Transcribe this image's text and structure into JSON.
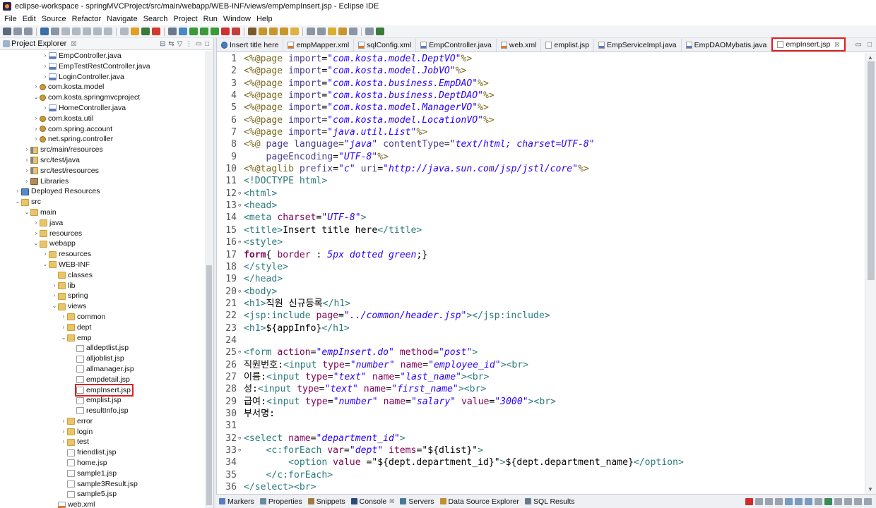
{
  "window": {
    "title": "eclipse-workspace - springMVCProject/src/main/webapp/WEB-INF/views/emp/empInsert.jsp - Eclipse IDE"
  },
  "menu": [
    "File",
    "Edit",
    "Source",
    "Refactor",
    "Navigate",
    "Search",
    "Project",
    "Run",
    "Window",
    "Help"
  ],
  "explorer": {
    "title": "Project Explorer",
    "close": "☒",
    "items": [
      {
        "depth": 5,
        "tw": "›",
        "icon": "java",
        "label": "EmpController.java"
      },
      {
        "depth": 5,
        "tw": "›",
        "icon": "java",
        "label": "EmpTestRestController.java"
      },
      {
        "depth": 5,
        "tw": "›",
        "icon": "java",
        "label": "LoginController.java"
      },
      {
        "depth": 4,
        "tw": "›",
        "icon": "pkg",
        "label": "com.kosta.model"
      },
      {
        "depth": 4,
        "tw": "⌄",
        "icon": "pkg",
        "label": "com.kosta.springmvcproject"
      },
      {
        "depth": 5,
        "tw": "›",
        "icon": "java",
        "label": "HomeController.java"
      },
      {
        "depth": 4,
        "tw": "›",
        "icon": "pkg",
        "label": "com.kosta.util"
      },
      {
        "depth": 4,
        "tw": "›",
        "icon": "pkg",
        "label": "com.spring.account"
      },
      {
        "depth": 4,
        "tw": "›",
        "icon": "pkg",
        "label": "net.spring.controller"
      },
      {
        "depth": 3,
        "tw": "›",
        "icon": "src",
        "label": "src/main/resources"
      },
      {
        "depth": 3,
        "tw": "›",
        "icon": "src",
        "label": "src/test/java"
      },
      {
        "depth": 3,
        "tw": "›",
        "icon": "src",
        "label": "src/test/resources"
      },
      {
        "depth": 3,
        "tw": "›",
        "icon": "lib",
        "label": "Libraries"
      },
      {
        "depth": 2,
        "tw": "›",
        "icon": "deploy",
        "label": "Deployed Resources"
      },
      {
        "depth": 2,
        "tw": "⌄",
        "icon": "folder",
        "label": "src"
      },
      {
        "depth": 3,
        "tw": "⌄",
        "icon": "folder",
        "label": "main"
      },
      {
        "depth": 4,
        "tw": "›",
        "icon": "folder",
        "label": "java"
      },
      {
        "depth": 4,
        "tw": "›",
        "icon": "folder",
        "label": "resources"
      },
      {
        "depth": 4,
        "tw": "⌄",
        "icon": "folder",
        "label": "webapp"
      },
      {
        "depth": 5,
        "tw": "›",
        "icon": "folder",
        "label": "resources"
      },
      {
        "depth": 5,
        "tw": "⌄",
        "icon": "folder",
        "label": "WEB-INF"
      },
      {
        "depth": 6,
        "tw": "",
        "icon": "folder",
        "label": "classes"
      },
      {
        "depth": 6,
        "tw": "›",
        "icon": "folder",
        "label": "lib"
      },
      {
        "depth": 6,
        "tw": "›",
        "icon": "folder",
        "label": "spring"
      },
      {
        "depth": 6,
        "tw": "⌄",
        "icon": "folder",
        "label": "views"
      },
      {
        "depth": 7,
        "tw": "›",
        "icon": "folder",
        "label": "common"
      },
      {
        "depth": 7,
        "tw": "›",
        "icon": "folder",
        "label": "dept"
      },
      {
        "depth": 7,
        "tw": "⌄",
        "icon": "folder",
        "label": "emp"
      },
      {
        "depth": 8,
        "tw": "",
        "icon": "jsp",
        "label": "alldeptlist.jsp"
      },
      {
        "depth": 8,
        "tw": "",
        "icon": "jsp",
        "label": "alljoblist.jsp"
      },
      {
        "depth": 8,
        "tw": "",
        "icon": "jsp",
        "label": "allmanager.jsp"
      },
      {
        "depth": 8,
        "tw": "",
        "icon": "jsp",
        "label": "empdetail.jsp"
      },
      {
        "depth": 8,
        "tw": "",
        "icon": "jsp",
        "label": "empInsert.jsp",
        "highlight": true
      },
      {
        "depth": 8,
        "tw": "",
        "icon": "jsp",
        "label": "emplist.jsp"
      },
      {
        "depth": 8,
        "tw": "",
        "icon": "jsp",
        "label": "resultInfo.jsp"
      },
      {
        "depth": 7,
        "tw": "›",
        "icon": "folder",
        "label": "error"
      },
      {
        "depth": 7,
        "tw": "›",
        "icon": "folder",
        "label": "login"
      },
      {
        "depth": 7,
        "tw": "›",
        "icon": "folder",
        "label": "test"
      },
      {
        "depth": 7,
        "tw": "",
        "icon": "jsp",
        "label": "friendlist.jsp"
      },
      {
        "depth": 7,
        "tw": "",
        "icon": "jsp",
        "label": "home.jsp"
      },
      {
        "depth": 7,
        "tw": "",
        "icon": "jsp",
        "label": "sample1.jsp"
      },
      {
        "depth": 7,
        "tw": "",
        "icon": "jsp",
        "label": "sample3Result.jsp"
      },
      {
        "depth": 7,
        "tw": "",
        "icon": "jsp",
        "label": "sample5.jsp"
      },
      {
        "depth": 6,
        "tw": "",
        "icon": "xml",
        "label": "web.xml"
      }
    ]
  },
  "tabs": [
    {
      "label": "Insert title here",
      "icon": "browser"
    },
    {
      "label": "empMapper.xml",
      "icon": "xml"
    },
    {
      "label": "sqlConfig.xml",
      "icon": "xml"
    },
    {
      "label": "EmpController.java",
      "icon": "java"
    },
    {
      "label": "web.xml",
      "icon": "xml"
    },
    {
      "label": "emplist.jsp",
      "icon": "jsp"
    },
    {
      "label": "EmpServiceImpl.java",
      "icon": "java"
    },
    {
      "label": "EmpDAOMybatis.java",
      "icon": "java"
    },
    {
      "label": "empInsert.jsp",
      "icon": "jsp",
      "active": true,
      "close": "☒"
    }
  ],
  "code_lines": [
    {
      "n": "1",
      "fold": "",
      "segs": [
        [
          "dir",
          "<%@page "
        ],
        [
          "kw",
          "import"
        ],
        [
          "plain",
          "="
        ],
        [
          "str",
          "\"com.kosta.model.DeptVO\""
        ],
        [
          "dir",
          "%>"
        ]
      ]
    },
    {
      "n": "2",
      "fold": "",
      "segs": [
        [
          "dir",
          "<%@page "
        ],
        [
          "kw",
          "import"
        ],
        [
          "plain",
          "="
        ],
        [
          "str",
          "\"com.kosta.model.JobVO\""
        ],
        [
          "dir",
          "%>"
        ]
      ]
    },
    {
      "n": "3",
      "fold": "",
      "segs": [
        [
          "dir",
          "<%@page "
        ],
        [
          "kw",
          "import"
        ],
        [
          "plain",
          "="
        ],
        [
          "str",
          "\"com.kosta.business.EmpDAO\""
        ],
        [
          "dir",
          "%>"
        ]
      ]
    },
    {
      "n": "4",
      "fold": "",
      "segs": [
        [
          "dir",
          "<%@page "
        ],
        [
          "kw",
          "import"
        ],
        [
          "plain",
          "="
        ],
        [
          "str",
          "\"com.kosta.business.DeptDAO\""
        ],
        [
          "dir",
          "%>"
        ]
      ]
    },
    {
      "n": "5",
      "fold": "",
      "segs": [
        [
          "dir",
          "<%@page "
        ],
        [
          "kw",
          "import"
        ],
        [
          "plain",
          "="
        ],
        [
          "str",
          "\"com.kosta.model.ManagerVO\""
        ],
        [
          "dir",
          "%>"
        ]
      ]
    },
    {
      "n": "6",
      "fold": "",
      "segs": [
        [
          "dir",
          "<%@page "
        ],
        [
          "kw",
          "import"
        ],
        [
          "plain",
          "="
        ],
        [
          "str",
          "\"com.kosta.model.LocationVO\""
        ],
        [
          "dir",
          "%>"
        ]
      ]
    },
    {
      "n": "7",
      "fold": "",
      "segs": [
        [
          "dir",
          "<%@page "
        ],
        [
          "kw",
          "import"
        ],
        [
          "plain",
          "="
        ],
        [
          "str",
          "\"java.util.List\""
        ],
        [
          "dir",
          "%>"
        ]
      ]
    },
    {
      "n": "8",
      "fold": "",
      "segs": [
        [
          "dir",
          "<%@ "
        ],
        [
          "kw",
          "page language"
        ],
        [
          "plain",
          "="
        ],
        [
          "str",
          "\"java\""
        ],
        [
          "plain",
          " "
        ],
        [
          "kw",
          "contentType"
        ],
        [
          "plain",
          "="
        ],
        [
          "str",
          "\"text/html; charset=UTF-8\""
        ]
      ]
    },
    {
      "n": "9",
      "fold": "",
      "segs": [
        [
          "plain",
          "    "
        ],
        [
          "kw",
          "pageEncoding"
        ],
        [
          "plain",
          "="
        ],
        [
          "str",
          "\"UTF-8\""
        ],
        [
          "dir",
          "%>"
        ]
      ]
    },
    {
      "n": "10",
      "fold": "",
      "segs": [
        [
          "dir",
          "<%@taglib "
        ],
        [
          "kw",
          "prefix"
        ],
        [
          "plain",
          "="
        ],
        [
          "str",
          "\"c\""
        ],
        [
          "plain",
          " "
        ],
        [
          "kw",
          "uri"
        ],
        [
          "plain",
          "="
        ],
        [
          "str",
          "\"http://java.sun.com/jsp/jstl/core\""
        ],
        [
          "dir",
          "%>"
        ]
      ]
    },
    {
      "n": "11",
      "fold": "",
      "segs": [
        [
          "tag",
          "<!DOCTYPE "
        ],
        [
          "el",
          "html"
        ],
        [
          "tag",
          ">"
        ]
      ]
    },
    {
      "n": "12",
      "fold": "⊖",
      "segs": [
        [
          "tag",
          "<html>"
        ]
      ]
    },
    {
      "n": "13",
      "fold": "⊖",
      "segs": [
        [
          "tag",
          "<head>"
        ]
      ]
    },
    {
      "n": "14",
      "fold": "",
      "segs": [
        [
          "tag",
          "<meta "
        ],
        [
          "attr",
          "charset"
        ],
        [
          "plain",
          "="
        ],
        [
          "str",
          "\"UTF-8\""
        ],
        [
          "tag",
          ">"
        ]
      ]
    },
    {
      "n": "15",
      "fold": "",
      "segs": [
        [
          "tag",
          "<title>"
        ],
        [
          "plain",
          "Insert title here"
        ],
        [
          "tag",
          "</title>"
        ]
      ]
    },
    {
      "n": "16",
      "fold": "⊖",
      "segs": [
        [
          "tag",
          "<style>"
        ]
      ]
    },
    {
      "n": "17",
      "fold": "",
      "segs": [
        [
          "css",
          "form"
        ],
        [
          "plain",
          "{ "
        ],
        [
          "attr",
          "border"
        ],
        [
          "plain",
          " : "
        ],
        [
          "str",
          "5px dotted green"
        ],
        [
          "plain",
          ";}"
        ]
      ]
    },
    {
      "n": "18",
      "fold": "",
      "segs": [
        [
          "tag",
          "</style>"
        ]
      ]
    },
    {
      "n": "19",
      "fold": "",
      "segs": [
        [
          "tag",
          "</head>"
        ]
      ]
    },
    {
      "n": "20",
      "fold": "⊖",
      "segs": [
        [
          "tag",
          "<body>"
        ]
      ]
    },
    {
      "n": "21",
      "fold": "",
      "segs": [
        [
          "tag",
          "<h1>"
        ],
        [
          "plain",
          "직원 신규등록"
        ],
        [
          "tag",
          "</h1>"
        ]
      ]
    },
    {
      "n": "22",
      "fold": "",
      "segs": [
        [
          "tag",
          "<jsp:include "
        ],
        [
          "attr",
          "page"
        ],
        [
          "plain",
          "="
        ],
        [
          "str",
          "\"../common/header.jsp\""
        ],
        [
          "tag",
          "></jsp:include>"
        ]
      ]
    },
    {
      "n": "23",
      "fold": "",
      "segs": [
        [
          "tag",
          "<h1>"
        ],
        [
          "plain",
          "${appInfo}"
        ],
        [
          "tag",
          "</h1>"
        ]
      ]
    },
    {
      "n": "24",
      "fold": "",
      "segs": []
    },
    {
      "n": "25",
      "fold": "⊖",
      "segs": [
        [
          "tag",
          "<form "
        ],
        [
          "attr",
          "action"
        ],
        [
          "plain",
          "="
        ],
        [
          "str",
          "\"empInsert.do\""
        ],
        [
          "plain",
          " "
        ],
        [
          "attr",
          "method"
        ],
        [
          "plain",
          "="
        ],
        [
          "str",
          "\"post\""
        ],
        [
          "tag",
          ">"
        ]
      ]
    },
    {
      "n": "26",
      "fold": "",
      "segs": [
        [
          "plain",
          "직원번호:"
        ],
        [
          "tag",
          "<input "
        ],
        [
          "attr",
          "type"
        ],
        [
          "plain",
          "="
        ],
        [
          "str",
          "\"number\""
        ],
        [
          "plain",
          " "
        ],
        [
          "attr",
          "name"
        ],
        [
          "plain",
          "="
        ],
        [
          "str",
          "\"employee_id\""
        ],
        [
          "tag",
          "><br>"
        ]
      ]
    },
    {
      "n": "27",
      "fold": "",
      "segs": [
        [
          "plain",
          "이름:"
        ],
        [
          "tag",
          "<input "
        ],
        [
          "attr",
          "type"
        ],
        [
          "plain",
          "="
        ],
        [
          "str",
          "\"text\""
        ],
        [
          "plain",
          " "
        ],
        [
          "attr",
          "name"
        ],
        [
          "plain",
          "="
        ],
        [
          "str",
          "\"last_name\""
        ],
        [
          "tag",
          "><br>"
        ]
      ]
    },
    {
      "n": "28",
      "fold": "",
      "segs": [
        [
          "plain",
          "성:"
        ],
        [
          "tag",
          "<input "
        ],
        [
          "attr",
          "type"
        ],
        [
          "plain",
          "="
        ],
        [
          "str",
          "\"text\""
        ],
        [
          "plain",
          " "
        ],
        [
          "attr",
          "name"
        ],
        [
          "plain",
          "="
        ],
        [
          "str",
          "\"first_name\""
        ],
        [
          "tag",
          "><br>"
        ]
      ]
    },
    {
      "n": "29",
      "fold": "",
      "segs": [
        [
          "plain",
          "급여:"
        ],
        [
          "tag",
          "<input "
        ],
        [
          "attr",
          "type"
        ],
        [
          "plain",
          "="
        ],
        [
          "str",
          "\"number\""
        ],
        [
          "plain",
          " "
        ],
        [
          "attr",
          "name"
        ],
        [
          "plain",
          "="
        ],
        [
          "str",
          "\"salary\""
        ],
        [
          "plain",
          " "
        ],
        [
          "attr",
          "value"
        ],
        [
          "plain",
          "="
        ],
        [
          "str",
          "\"3000\""
        ],
        [
          "tag",
          "><br>"
        ]
      ]
    },
    {
      "n": "30",
      "fold": "",
      "segs": [
        [
          "plain",
          "부서명:"
        ]
      ]
    },
    {
      "n": "31",
      "fold": "",
      "segs": []
    },
    {
      "n": "32",
      "fold": "⊖",
      "segs": [
        [
          "tag",
          "<select "
        ],
        [
          "attr",
          "name"
        ],
        [
          "plain",
          "="
        ],
        [
          "str",
          "\"department_id\""
        ],
        [
          "tag",
          ">"
        ]
      ]
    },
    {
      "n": "33",
      "fold": "⊖",
      "segs": [
        [
          "plain",
          "    "
        ],
        [
          "tag",
          "<c:forEach "
        ],
        [
          "attr",
          "var"
        ],
        [
          "plain",
          "="
        ],
        [
          "str",
          "\"dept\""
        ],
        [
          "plain",
          " "
        ],
        [
          "attr",
          "items"
        ],
        [
          "plain",
          "="
        ],
        [
          "plain",
          "\"${dlist}\""
        ],
        [
          "tag",
          ">"
        ]
      ]
    },
    {
      "n": "34",
      "fold": "",
      "segs": [
        [
          "plain",
          "        "
        ],
        [
          "tag",
          "<option "
        ],
        [
          "attr",
          "value"
        ],
        [
          "plain",
          " ="
        ],
        [
          "plain",
          "\"${dept.department_id}\""
        ],
        [
          "tag",
          ">"
        ],
        [
          "plain",
          "${dept.department_name}"
        ],
        [
          "tag",
          "</option>"
        ]
      ]
    },
    {
      "n": "35",
      "fold": "",
      "segs": [
        [
          "plain",
          "    "
        ],
        [
          "tag",
          "</c:forEach>"
        ]
      ]
    },
    {
      "n": "36",
      "fold": "",
      "segs": [
        [
          "tag",
          "</select><br>"
        ]
      ]
    }
  ],
  "bottom_tabs": [
    {
      "label": "Markers",
      "color": "#5a7bc0"
    },
    {
      "label": "Properties",
      "color": "#6a8aa0"
    },
    {
      "label": "Snippets",
      "color": "#a07a3a"
    },
    {
      "label": "Console",
      "color": "#2a4a7a",
      "close": "☒"
    },
    {
      "label": "Servers",
      "color": "#4a7a9a"
    },
    {
      "label": "Data Source Explorer",
      "color": "#c09030"
    },
    {
      "label": "SQL Results",
      "color": "#6a7a8a"
    }
  ]
}
